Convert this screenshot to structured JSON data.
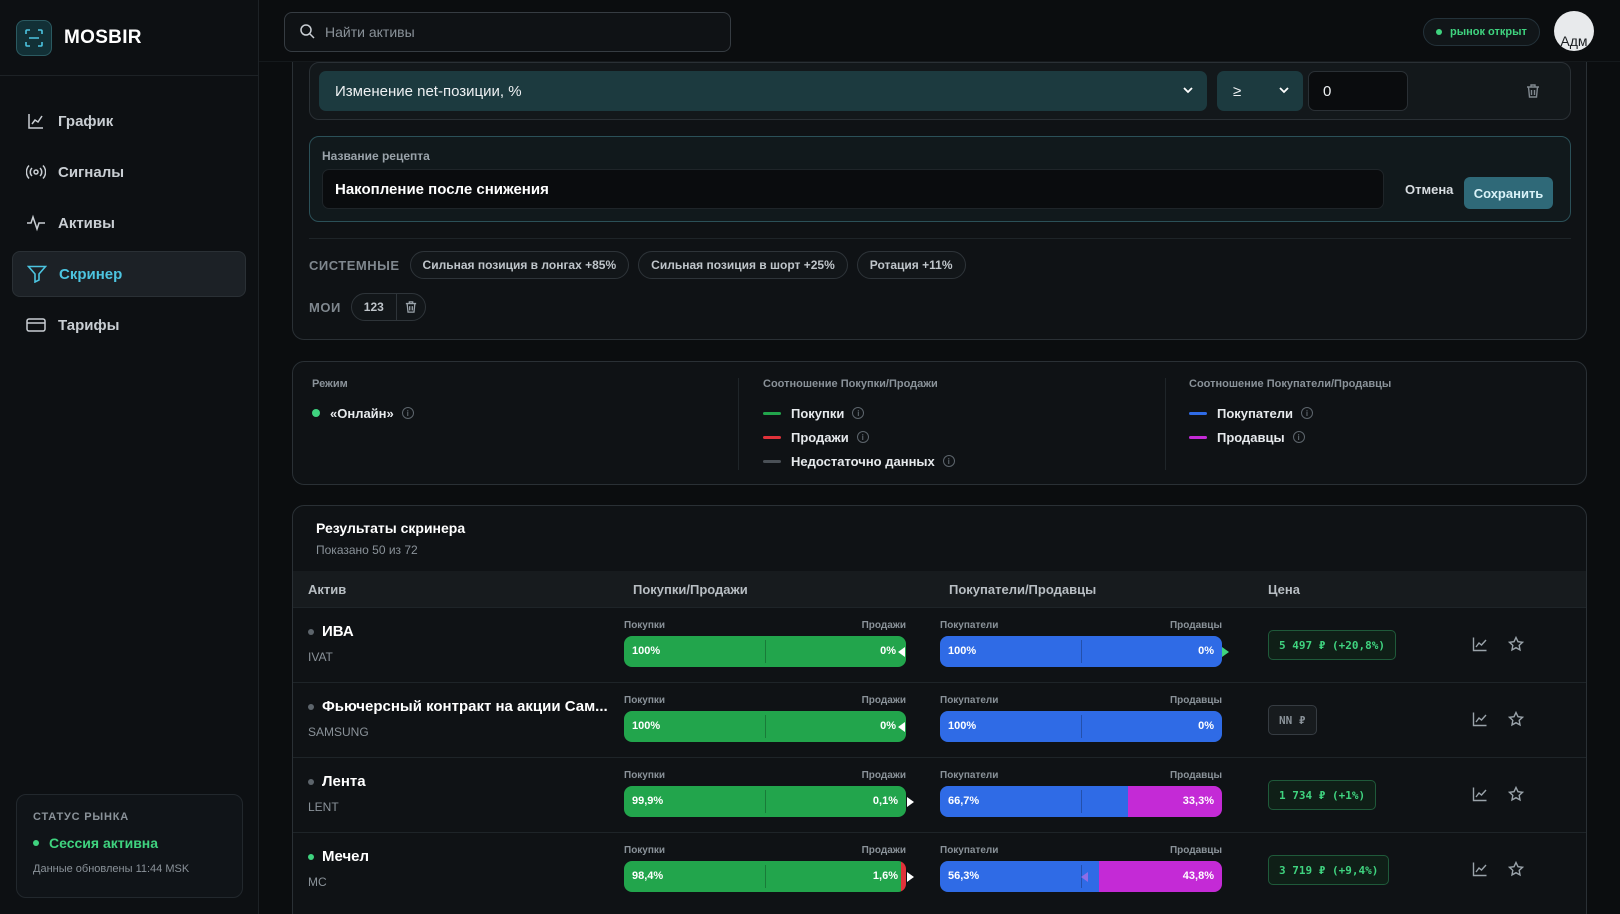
{
  "app": {
    "name": "MOSBIR"
  },
  "sidebar": {
    "items": [
      {
        "label": "График",
        "icon": "chart-line-icon",
        "active": false
      },
      {
        "label": "Сигналы",
        "icon": "broadcast-icon",
        "active": false
      },
      {
        "label": "Активы",
        "icon": "activity-icon",
        "active": false
      },
      {
        "label": "Скринер",
        "icon": "filter-icon",
        "active": true
      },
      {
        "label": "Тарифы",
        "icon": "credit-card-icon",
        "active": false
      }
    ],
    "status": {
      "title": "СТАТУС РЫНКА",
      "session": "Сессия активна",
      "updated": "Данные обновлены 11:44 MSK"
    }
  },
  "topbar": {
    "search_placeholder": "Найти активы",
    "market_status": "рынок открыт",
    "avatar_text": "Адм"
  },
  "filter": {
    "condition": {
      "field": "Изменение net-позиции, %",
      "operator": "≥",
      "value": "0"
    },
    "recipe": {
      "label": "Название рецепта",
      "name": "Накопление после снижения",
      "cancel": "Отмена",
      "save": "Сохранить"
    },
    "system_label": "СИСТЕМНЫЕ",
    "system_presets": [
      "Сильная позиция в лонгах +85%",
      "Сильная позиция в шорт +25%",
      "Ротация +11%"
    ],
    "my_label": "МОИ",
    "my_presets": [
      "123"
    ]
  },
  "legend": {
    "mode": {
      "title": "Режим",
      "items": [
        {
          "label": "«Онлайн»",
          "color": "#3fd37f"
        }
      ]
    },
    "buy_sell": {
      "title": "Соотношение Покупки/Продажи",
      "items": [
        {
          "label": "Покупки",
          "color": "#22a54c"
        },
        {
          "label": "Продажи",
          "color": "#e0323a"
        },
        {
          "label": "Недостаточно данных",
          "color": "#4a5056"
        }
      ]
    },
    "buyers_sellers": {
      "title": "Соотношение Покупатели/Продавцы",
      "items": [
        {
          "label": "Покупатели",
          "color": "#2f6be6"
        },
        {
          "label": "Продавцы",
          "color": "#c42ad6"
        }
      ]
    }
  },
  "results": {
    "title": "Результаты скринера",
    "subtitle": "Показано 50 из 72",
    "columns": {
      "asset": "Актив",
      "buy_sell": "Покупки/Продажи",
      "buyers_sellers": "Покупатели/Продавцы",
      "price": "Цена"
    },
    "bar_labels": {
      "buy": "Покупки",
      "sell": "Продажи",
      "buyers": "Покупатели",
      "sellers": "Продавцы"
    },
    "rows": [
      {
        "name": "ИВА",
        "ticker": "IVAT",
        "status_color": "#5d656c",
        "buy": "100%",
        "sell": "0%",
        "buy_pct": 100,
        "buyers": "100%",
        "sellers": "0%",
        "buyers_pct": 100,
        "price": "5 497 ₽ (+20,8%)",
        "price_state": "up"
      },
      {
        "name": "Фьючерсный контракт на акции Сам...",
        "ticker": "SAMSUNG",
        "status_color": "#5d656c",
        "buy": "100%",
        "sell": "0%",
        "buy_pct": 100,
        "buyers": "100%",
        "sellers": "0%",
        "buyers_pct": 100,
        "price": "NN ₽",
        "price_state": "na"
      },
      {
        "name": "Лента",
        "ticker": "LENT",
        "status_color": "#5d656c",
        "buy": "99,9%",
        "sell": "0,1%",
        "buy_pct": 99.9,
        "buyers": "66,7%",
        "sellers": "33,3%",
        "buyers_pct": 66.7,
        "price": "1 734 ₽ (+1%)",
        "price_state": "up"
      },
      {
        "name": "Мечел",
        "ticker": "MC",
        "status_color": "#3fd37f",
        "buy": "98,4%",
        "sell": "1,6%",
        "buy_pct": 98.4,
        "buyers": "56,3%",
        "sellers": "43,8%",
        "buyers_pct": 56.3,
        "price": "3 719 ₽ (+9,4%)",
        "price_state": "up"
      }
    ]
  }
}
